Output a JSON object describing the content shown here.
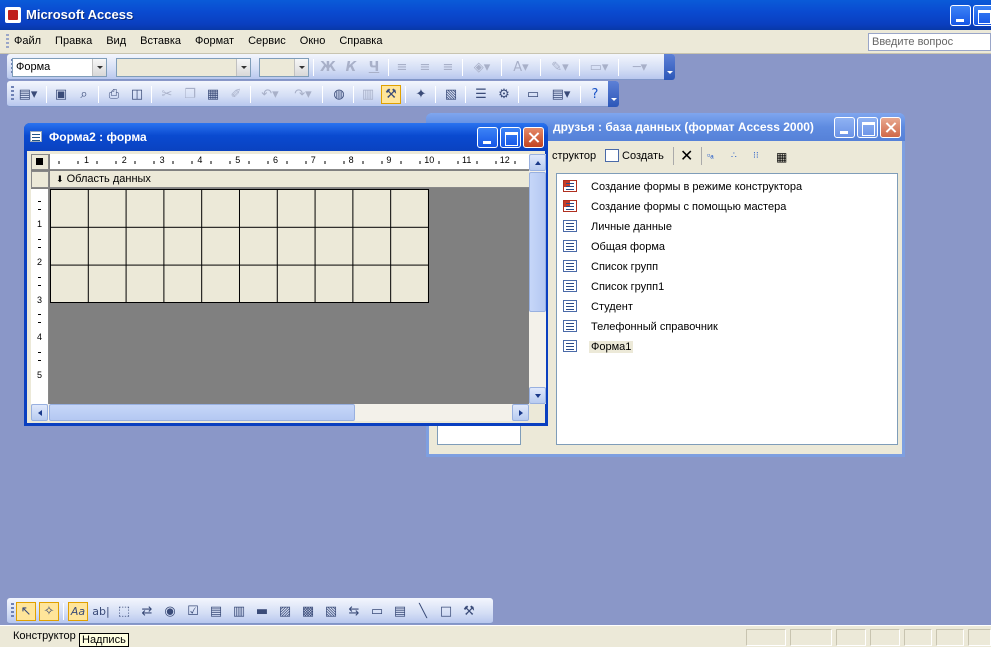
{
  "app": {
    "title": "Microsoft Access"
  },
  "menu": {
    "items": [
      "Файл",
      "Правка",
      "Вид",
      "Вставка",
      "Формат",
      "Сервис",
      "Окно",
      "Справка"
    ],
    "question_placeholder": "Введите вопрос"
  },
  "formatting_toolbar": {
    "object_combo": "Форма",
    "bold": "Ж",
    "italic": "К",
    "underline": "Ч"
  },
  "form_window": {
    "title": "Форма2 : форма",
    "section_label": "Область данных",
    "hruler_numbers": [
      "1",
      "2",
      "3",
      "4",
      "5",
      "6",
      "7",
      "8",
      "9",
      "10",
      "11",
      "12"
    ],
    "vruler_numbers": [
      "1",
      "2",
      "3",
      "4",
      "5"
    ]
  },
  "db_window": {
    "title": "друзья : база данных (формат Access 2000)",
    "toolbar": {
      "designer": "структор",
      "create": "Создать"
    },
    "objects": [
      {
        "label": "Создание формы в режиме конструктора",
        "icon": "wizard-form-icon"
      },
      {
        "label": "Создание формы с помощью мастера",
        "icon": "wizard-form-icon"
      },
      {
        "label": "Личные данные",
        "icon": "form-icon"
      },
      {
        "label": "Общая форма",
        "icon": "form-icon"
      },
      {
        "label": "Список групп",
        "icon": "form-icon"
      },
      {
        "label": "Список групп1",
        "icon": "form-icon"
      },
      {
        "label": "Студент",
        "icon": "form-icon"
      },
      {
        "label": "Телефонный справочник",
        "icon": "form-icon"
      },
      {
        "label": "Форма1",
        "icon": "form-icon",
        "selected": true
      }
    ]
  },
  "toolbox": {
    "label_tool": "Aa",
    "textbox_tool": "ab|"
  },
  "statusbar": {
    "text": "Конструктор"
  },
  "tooltip": {
    "text": "Надпись"
  },
  "colors": {
    "titlebar": "#0a4ad0",
    "desktop": "#8a97c8",
    "form_canvas": "#808080",
    "grid": "#ece9d8"
  }
}
